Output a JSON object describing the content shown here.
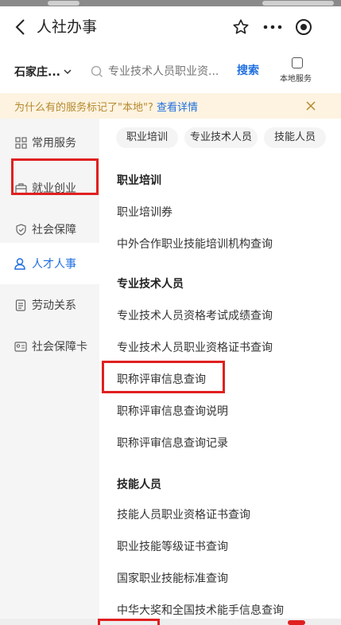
{
  "navbar": {
    "title": "人社办事",
    "back_icon": "chevron-left-icon",
    "star_icon": "star-icon",
    "more_icon": "more-icon",
    "target_icon": "target-icon"
  },
  "search": {
    "city": "石家庄...",
    "placeholder": "专业技术人员职业资...",
    "button": "搜索",
    "local_label": "本地服务"
  },
  "notice": {
    "text": "为什么有的服务标记了\"本地\"?",
    "link": "查看详情",
    "close_icon": "close-icon"
  },
  "sidebar": {
    "items": [
      {
        "label": "常用服务",
        "icon": "grid-icon"
      },
      {
        "label": "就业创业",
        "icon": "briefcase-icon"
      },
      {
        "label": "社会保障",
        "icon": "shield-icon"
      },
      {
        "label": "人才人事",
        "icon": "user-icon"
      },
      {
        "label": "劳动关系",
        "icon": "document-icon"
      },
      {
        "label": "社会保障卡",
        "icon": "id-card-icon"
      }
    ]
  },
  "tags": [
    "职业培训",
    "专业技术人员",
    "技能人员"
  ],
  "content": {
    "items": [
      {
        "label": "职业培训",
        "type": "header"
      },
      {
        "label": "职业培训券",
        "type": "item"
      },
      {
        "label": "中外合作职业技能培训机构查询",
        "type": "item"
      },
      {
        "label": "专业技术人员",
        "type": "header"
      },
      {
        "label": "专业技术人员资格考试成绩查询",
        "type": "item"
      },
      {
        "label": "专业技术人员职业资格证书查询",
        "type": "item"
      },
      {
        "label": "职称评审信息查询",
        "type": "item"
      },
      {
        "label": "职称评审信息查询说明",
        "type": "item"
      },
      {
        "label": "职称评审信息查询记录",
        "type": "item"
      },
      {
        "label": "技能人员",
        "type": "header"
      },
      {
        "label": "技能人员职业资格证书查询",
        "type": "item"
      },
      {
        "label": "职业技能等级证书查询",
        "type": "item"
      },
      {
        "label": "国家职业技能标准查询",
        "type": "item"
      },
      {
        "label": "中华大奖和全国技术能手信息查询",
        "type": "item"
      }
    ]
  },
  "colors": {
    "accent": "#1f6fe0",
    "highlight": "#e02020",
    "notice_bg": "#fdf3e0",
    "notice_text": "#b5892f"
  }
}
